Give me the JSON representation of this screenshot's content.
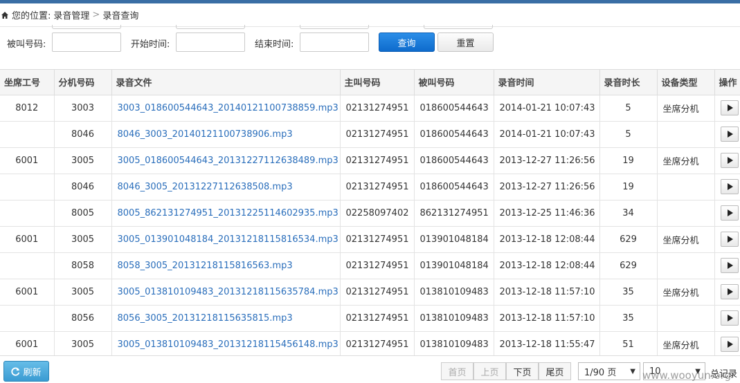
{
  "breadcrumb": {
    "prefix": "您的位置:",
    "section": "录音管理",
    "separator": ">",
    "page": "录音查询"
  },
  "filters": {
    "called_label": "被叫号码:",
    "start_label": "开始时间:",
    "end_label": "结束时间:",
    "search_label": "查询",
    "reset_label": "重置"
  },
  "table": {
    "headers": [
      "坐席工号",
      "分机号码",
      "录音文件",
      "主叫号码",
      "被叫号码",
      "录音时间",
      "录音时长",
      "设备类型",
      "操作"
    ],
    "rows": [
      [
        "8012",
        "3003",
        "3003_018600544643_20140121100738859.mp3",
        "02131274951",
        "018600544643",
        "2014-01-21 10:07:43",
        "5",
        "坐席分机"
      ],
      [
        "",
        "8046",
        "8046_3003_20140121100738906.mp3",
        "02131274951",
        "018600544643",
        "2014-01-21 10:07:43",
        "5",
        ""
      ],
      [
        "6001",
        "3005",
        "3005_018600544643_20131227112638489.mp3",
        "02131274951",
        "018600544643",
        "2013-12-27 11:26:56",
        "19",
        "坐席分机"
      ],
      [
        "",
        "8046",
        "8046_3005_20131227112638508.mp3",
        "02131274951",
        "018600544643",
        "2013-12-27 11:26:56",
        "19",
        ""
      ],
      [
        "",
        "8005",
        "8005_862131274951_20131225114602935.mp3",
        "02258097402",
        "862131274951",
        "2013-12-25 11:46:36",
        "34",
        ""
      ],
      [
        "6001",
        "3005",
        "3005_013901048184_20131218115816534.mp3",
        "02131274951",
        "013901048184",
        "2013-12-18 12:08:44",
        "629",
        "坐席分机"
      ],
      [
        "",
        "8058",
        "8058_3005_20131218115816563.mp3",
        "02131274951",
        "013901048184",
        "2013-12-18 12:08:44",
        "629",
        ""
      ],
      [
        "6001",
        "3005",
        "3005_013810109483_20131218115635784.mp3",
        "02131274951",
        "013810109483",
        "2013-12-18 11:57:10",
        "35",
        "坐席分机"
      ],
      [
        "",
        "8056",
        "8056_3005_20131218115635815.mp3",
        "02131274951",
        "013810109483",
        "2013-12-18 11:57:10",
        "35",
        ""
      ],
      [
        "6001",
        "3005",
        "3005_013810109483_20131218115456148.mp3",
        "02131274951",
        "013810109483",
        "2013-12-18 11:55:47",
        "51",
        "坐席分机"
      ]
    ]
  },
  "footer": {
    "refresh_label": "刷新",
    "first_label": "首页",
    "prev_label": "上页",
    "next_label": "下页",
    "last_label": "尾页",
    "page_select": "1/90 页",
    "page_size": "10",
    "total_label": "总记录"
  },
  "watermark": "www.wooyun.org",
  "colors": {
    "accent": "#3a6ea5",
    "primary_button": "#0e6bcc",
    "link": "#2a6ebb",
    "refresh_button": "#3a9bd2"
  }
}
